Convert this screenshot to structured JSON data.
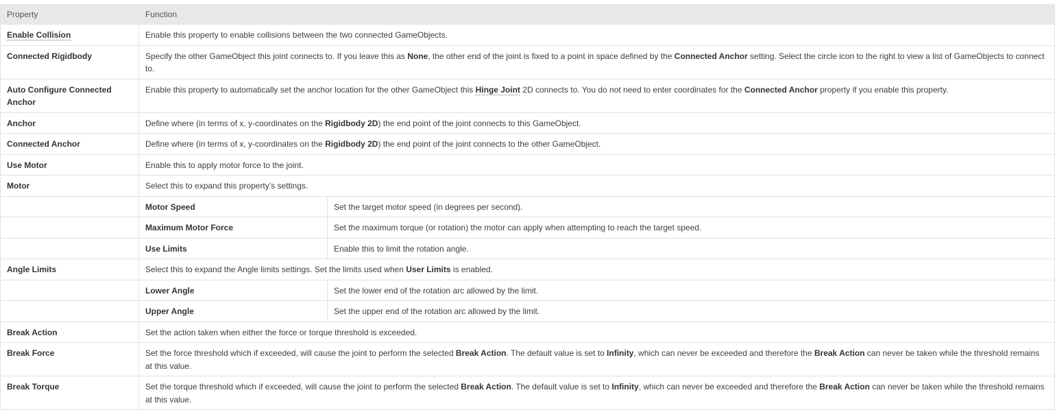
{
  "headers": {
    "property": "Property",
    "function": "Function"
  },
  "rows": {
    "enable_collision": {
      "prop": "Enable Collision",
      "desc": "Enable this property to enable collisions between the two connected GameObjects."
    },
    "connected_rigidbody": {
      "prop": "Connected Rigidbody",
      "desc_a": "Specify the other GameObject this joint connects to. If you leave this as ",
      "desc_b": "None",
      "desc_c": ", the other end of the joint is fixed to a point in space defined by the ",
      "desc_d": "Connected Anchor",
      "desc_e": " setting. Select the circle icon to the right to view a list of GameObjects to connect to."
    },
    "auto_configure": {
      "prop": "Auto Configure Connected Anchor",
      "desc_a": "Enable this property to automatically set the anchor location for the other GameObject this ",
      "desc_b": "Hinge Joint",
      "desc_c": " 2D connects to. You do not need to enter coordinates for the ",
      "desc_d": "Connected Anchor",
      "desc_e": " property if you enable this property."
    },
    "anchor": {
      "prop": "Anchor",
      "desc_a": "Define where (in terms of x, y-coordinates on the ",
      "desc_b": "Rigidbody 2D",
      "desc_c": ") the end point of the joint connects to this GameObject."
    },
    "connected_anchor": {
      "prop": "Connected Anchor",
      "desc_a": "Define where (in terms of x, y-coordinates on the ",
      "desc_b": "Rigidbody 2D",
      "desc_c": ") the end point of the joint connects to the other GameObject."
    },
    "use_motor": {
      "prop": "Use Motor",
      "desc": "Enable this to apply motor force to the joint."
    },
    "motor": {
      "prop": "Motor",
      "desc": "Select this to expand this property’s settings."
    },
    "motor_speed": {
      "prop": "Motor Speed",
      "desc": "Set the target motor speed (in degrees per second)."
    },
    "max_motor_force": {
      "prop": "Maximum Motor Force",
      "desc": "Set the maximum torque (or rotation) the motor can apply when attempting to reach the target speed."
    },
    "use_limits": {
      "prop": "Use Limits",
      "desc": "Enable this to limit the rotation angle."
    },
    "angle_limits": {
      "prop": "Angle Limits",
      "desc_a": "Select this to expand the Angle limits settings. Set the limits used when ",
      "desc_b": "User Limits",
      "desc_c": " is enabled."
    },
    "lower_angle": {
      "prop": "Lower Angle",
      "desc": "Set the lower end of the rotation arc allowed by the limit."
    },
    "upper_angle": {
      "prop": "Upper Angle",
      "desc": "Set the upper end of the rotation arc allowed by the limit."
    },
    "break_action": {
      "prop": "Break Action",
      "desc": "Set the action taken when either the force or torque threshold is exceeded."
    },
    "break_force": {
      "prop": "Break Force",
      "desc_a": "Set the force threshold which if exceeded, will cause the joint to perform the selected ",
      "desc_b": "Break Action",
      "desc_c": ". The default value is set to ",
      "desc_d": "Infinity",
      "desc_e": ", which can never be exceeded and therefore the ",
      "desc_f": "Break Action",
      "desc_g": " can never be taken while the threshold remains at this value."
    },
    "break_torque": {
      "prop": "Break Torque",
      "desc_a": "Set the torque threshold which if exceeded, will cause the joint to perform the selected ",
      "desc_b": "Break Action",
      "desc_c": ". The default value is set to ",
      "desc_d": "Infinity",
      "desc_e": ", which can never be exceeded and therefore the ",
      "desc_f": "Break Action",
      "desc_g": " can never be taken while the threshold remains at this value."
    }
  }
}
